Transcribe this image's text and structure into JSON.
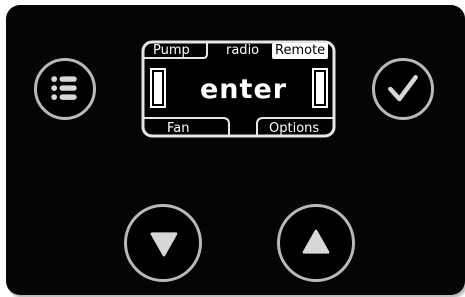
{
  "display": {
    "tabs": [
      {
        "label": "Pump",
        "selected": false
      },
      {
        "label": "radio",
        "selected": false
      },
      {
        "label": "Remote",
        "selected": true
      }
    ],
    "main_text": "enter",
    "softkeys": {
      "left": "Fan",
      "right": "Options"
    }
  },
  "buttons": {
    "menu": {
      "icon": "menu-list-icon"
    },
    "confirm": {
      "icon": "checkmark-icon"
    },
    "down": {
      "icon": "down-triangle-icon"
    },
    "up": {
      "icon": "up-triangle-icon"
    }
  },
  "colors": {
    "panel": "#050505",
    "ring": "#b9b9b9",
    "display_text": "#ffffff"
  }
}
